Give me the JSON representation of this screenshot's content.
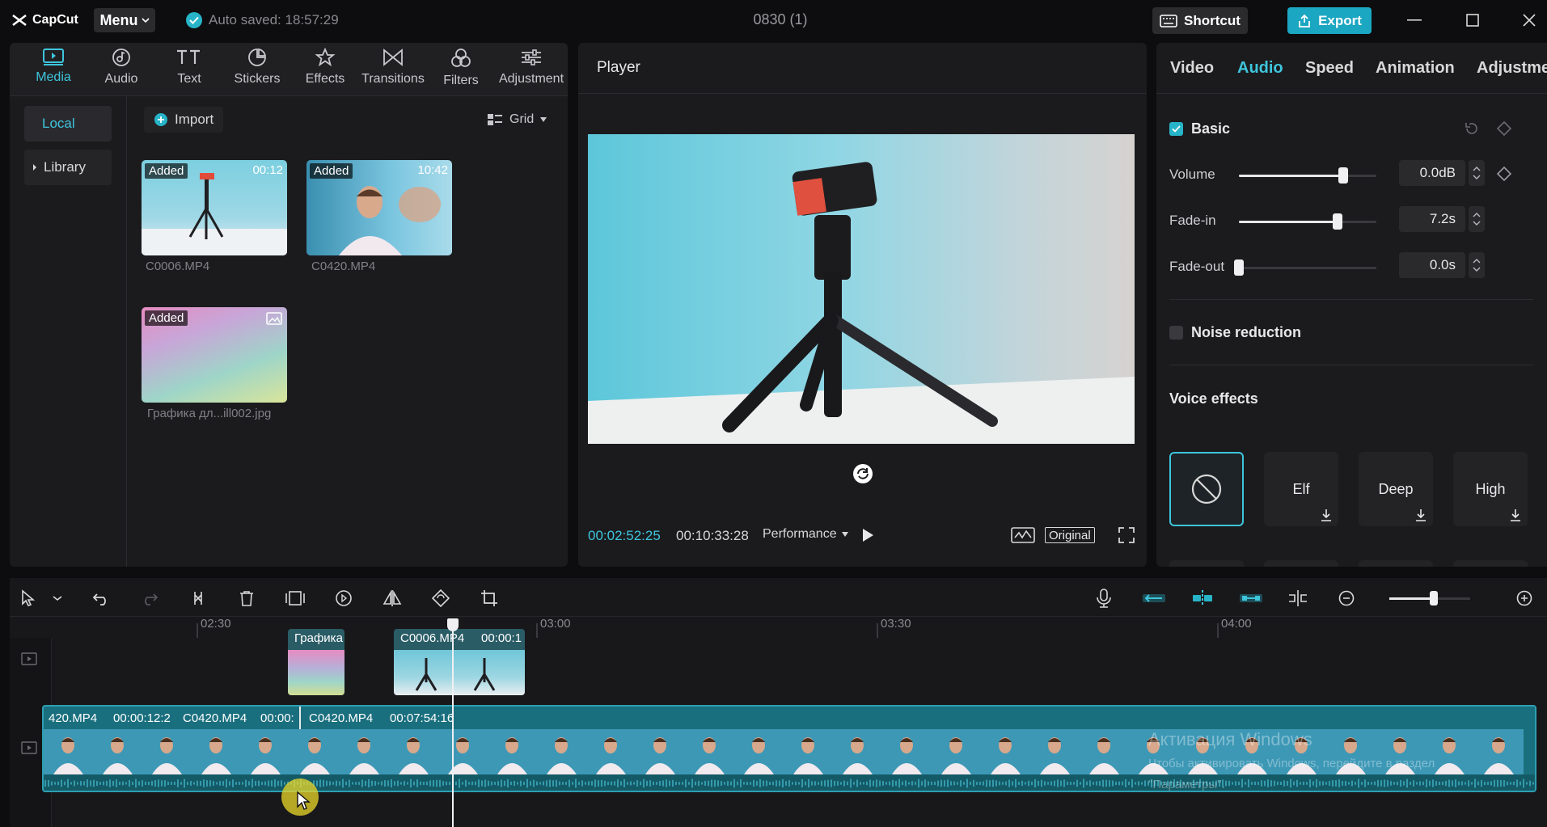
{
  "titlebar": {
    "app_name": "CapCut",
    "menu_label": "Menu",
    "autosave_text": "Auto saved: 18:57:29",
    "project_title": "0830 (1)",
    "shortcut_label": "Shortcut",
    "export_label": "Export"
  },
  "media_toolbar": {
    "items": [
      {
        "label": "Media",
        "icon": "media-icon",
        "active": true
      },
      {
        "label": "Audio",
        "icon": "audio-icon"
      },
      {
        "label": "Text",
        "icon": "text-icon"
      },
      {
        "label": "Stickers",
        "icon": "stickers-icon"
      },
      {
        "label": "Effects",
        "icon": "effects-icon"
      },
      {
        "label": "Transitions",
        "icon": "transitions-icon"
      },
      {
        "label": "Filters",
        "icon": "filters-icon"
      },
      {
        "label": "Adjustment",
        "icon": "adjustment-icon"
      }
    ]
  },
  "media_sidebar": {
    "local_label": "Local",
    "library_label": "Library"
  },
  "media": {
    "import_label": "Import",
    "view_label": "Grid",
    "items": [
      {
        "badge": "Added",
        "duration": "00:12",
        "filename": "C0006.MP4"
      },
      {
        "badge": "Added",
        "duration": "10:42",
        "filename": "C0420.MP4"
      },
      {
        "badge": "Added",
        "duration": "",
        "filename": "Графика дл...ill002.jpg"
      }
    ]
  },
  "player": {
    "title": "Player",
    "current_time": "00:02:52:25",
    "total_time": "00:10:33:28",
    "quality_label": "Performance",
    "ratio_label": "Original"
  },
  "inspector": {
    "tabs": [
      "Video",
      "Audio",
      "Speed",
      "Animation",
      "Adjustme"
    ],
    "active_tab": "Audio",
    "basic": {
      "label": "Basic",
      "checked": true,
      "volume": {
        "label": "Volume",
        "value": "0.0dB",
        "level": 0.76
      },
      "fade_in": {
        "label": "Fade-in",
        "value": "7.2s",
        "level": 0.72
      },
      "fade_out": {
        "label": "Fade-out",
        "value": "0.0s",
        "level": 0.0
      }
    },
    "noise_reduction": {
      "label": "Noise reduction",
      "checked": false
    },
    "voice_effects": {
      "title": "Voice effects",
      "items": [
        {
          "label": "",
          "icon": "none-icon",
          "selected": true
        },
        {
          "label": "Elf"
        },
        {
          "label": "Deep"
        },
        {
          "label": "High"
        }
      ]
    }
  },
  "timeline": {
    "ruler_labels": [
      "02:30",
      "03:00",
      "03:30",
      "04:00"
    ],
    "overlay_clips": [
      {
        "title": "Графика"
      },
      {
        "title": "C0006.MP4",
        "duration": "00:00:1"
      }
    ],
    "main_clips": [
      {
        "title": "420.MP4",
        "duration": "00:00:12:2"
      },
      {
        "title": "C0420.MP4",
        "duration": "00:00:"
      },
      {
        "title": "C0420.MP4",
        "duration": "00:07:54:16"
      }
    ],
    "zoom_level": 0.55,
    "watermark_title": "Активация Windows",
    "watermark_line1": "Чтобы активировать Windows, перейдите в раздел",
    "watermark_line2": "\"Параметры\"."
  }
}
